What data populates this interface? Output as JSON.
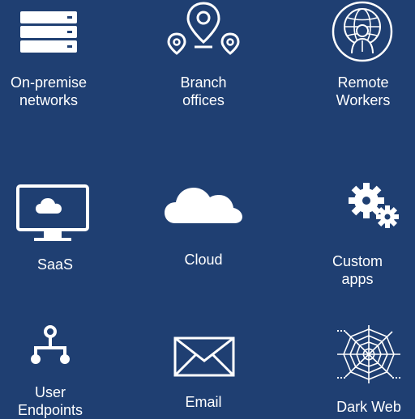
{
  "colors": {
    "background": "#1f3f72",
    "foreground": "#ffffff"
  },
  "tiles": [
    {
      "icon": "server-stack-icon",
      "lines": [
        "On-premise",
        "networks"
      ]
    },
    {
      "icon": "location-pins-icon",
      "lines": [
        "Branch",
        "offices"
      ]
    },
    {
      "icon": "globe-worker-icon",
      "lines": [
        "Remote",
        "Workers"
      ]
    },
    {
      "icon": "monitor-cloud-icon",
      "lines": [
        "SaaS"
      ]
    },
    {
      "icon": "cloud-icon",
      "lines": [
        "Cloud"
      ]
    },
    {
      "icon": "gears-icon",
      "lines": [
        "Custom",
        "apps"
      ]
    },
    {
      "icon": "network-nodes-icon",
      "lines": [
        "User",
        "Endpoints"
      ]
    },
    {
      "icon": "envelope-icon",
      "lines": [
        "Email"
      ]
    },
    {
      "icon": "spider-web-icon",
      "lines": [
        "Dark Web"
      ]
    }
  ]
}
